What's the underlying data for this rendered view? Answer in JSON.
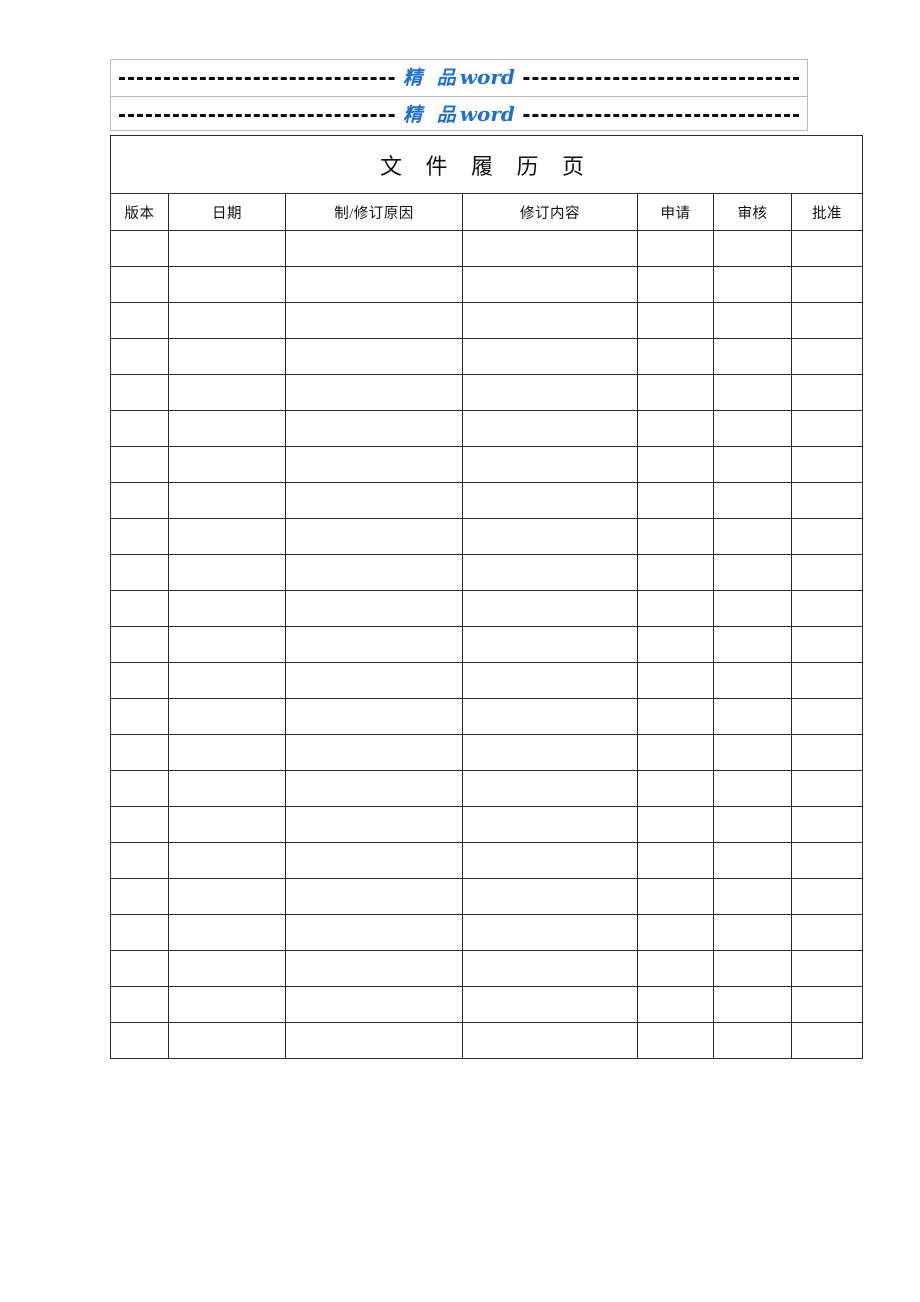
{
  "document": {
    "page_title": "文 件 履 历 页"
  },
  "header": {
    "watermark_rows": [
      {
        "cn": "精 品",
        "en": "word"
      },
      {
        "cn": "精 品",
        "en": "word"
      }
    ],
    "dash_color": "#0d0d0d",
    "watermark_color": "#1f6fd0"
  },
  "table": {
    "columns": [
      {
        "key": "version",
        "label": "版本"
      },
      {
        "key": "date",
        "label": "日期"
      },
      {
        "key": "reason",
        "label": "制/修订原因"
      },
      {
        "key": "content",
        "label": "修订内容"
      },
      {
        "key": "apply",
        "label": "申请"
      },
      {
        "key": "review",
        "label": "审核"
      },
      {
        "key": "approve",
        "label": "批准"
      }
    ],
    "row_count": 23,
    "rows": [
      {
        "version": "",
        "date": "",
        "reason": "",
        "content": "",
        "apply": "",
        "review": "",
        "approve": ""
      },
      {
        "version": "",
        "date": "",
        "reason": "",
        "content": "",
        "apply": "",
        "review": "",
        "approve": ""
      },
      {
        "version": "",
        "date": "",
        "reason": "",
        "content": "",
        "apply": "",
        "review": "",
        "approve": ""
      },
      {
        "version": "",
        "date": "",
        "reason": "",
        "content": "",
        "apply": "",
        "review": "",
        "approve": ""
      },
      {
        "version": "",
        "date": "",
        "reason": "",
        "content": "",
        "apply": "",
        "review": "",
        "approve": ""
      },
      {
        "version": "",
        "date": "",
        "reason": "",
        "content": "",
        "apply": "",
        "review": "",
        "approve": ""
      },
      {
        "version": "",
        "date": "",
        "reason": "",
        "content": "",
        "apply": "",
        "review": "",
        "approve": ""
      },
      {
        "version": "",
        "date": "",
        "reason": "",
        "content": "",
        "apply": "",
        "review": "",
        "approve": ""
      },
      {
        "version": "",
        "date": "",
        "reason": "",
        "content": "",
        "apply": "",
        "review": "",
        "approve": ""
      },
      {
        "version": "",
        "date": "",
        "reason": "",
        "content": "",
        "apply": "",
        "review": "",
        "approve": ""
      },
      {
        "version": "",
        "date": "",
        "reason": "",
        "content": "",
        "apply": "",
        "review": "",
        "approve": ""
      },
      {
        "version": "",
        "date": "",
        "reason": "",
        "content": "",
        "apply": "",
        "review": "",
        "approve": ""
      },
      {
        "version": "",
        "date": "",
        "reason": "",
        "content": "",
        "apply": "",
        "review": "",
        "approve": ""
      },
      {
        "version": "",
        "date": "",
        "reason": "",
        "content": "",
        "apply": "",
        "review": "",
        "approve": ""
      },
      {
        "version": "",
        "date": "",
        "reason": "",
        "content": "",
        "apply": "",
        "review": "",
        "approve": ""
      },
      {
        "version": "",
        "date": "",
        "reason": "",
        "content": "",
        "apply": "",
        "review": "",
        "approve": ""
      },
      {
        "version": "",
        "date": "",
        "reason": "",
        "content": "",
        "apply": "",
        "review": "",
        "approve": ""
      },
      {
        "version": "",
        "date": "",
        "reason": "",
        "content": "",
        "apply": "",
        "review": "",
        "approve": ""
      },
      {
        "version": "",
        "date": "",
        "reason": "",
        "content": "",
        "apply": "",
        "review": "",
        "approve": ""
      },
      {
        "version": "",
        "date": "",
        "reason": "",
        "content": "",
        "apply": "",
        "review": "",
        "approve": ""
      },
      {
        "version": "",
        "date": "",
        "reason": "",
        "content": "",
        "apply": "",
        "review": "",
        "approve": ""
      },
      {
        "version": "",
        "date": "",
        "reason": "",
        "content": "",
        "apply": "",
        "review": "",
        "approve": ""
      },
      {
        "version": "",
        "date": "",
        "reason": "",
        "content": "",
        "apply": "",
        "review": "",
        "approve": ""
      }
    ]
  }
}
